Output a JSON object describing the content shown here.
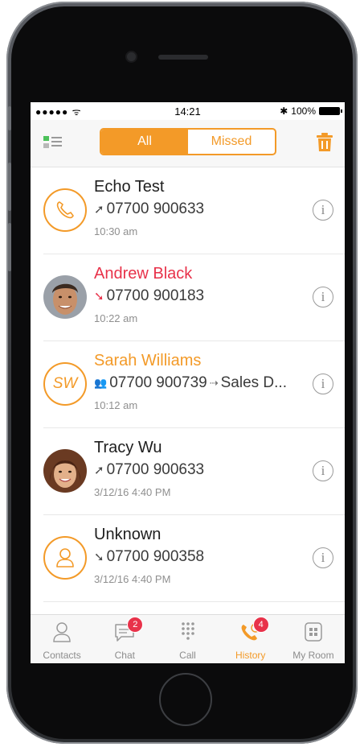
{
  "status": {
    "signal": "●●●●● ",
    "time": "14:21",
    "battery": "100%"
  },
  "header": {
    "tabs": [
      "All",
      "Missed"
    ],
    "active_tab": "All",
    "accent": "#f39a28"
  },
  "calls": [
    {
      "name": "Echo Test",
      "number": "07700 900633",
      "time": "10:30 am",
      "direction": "outgoing",
      "avatar": "phone-icon"
    },
    {
      "name": "Andrew Black",
      "number": "07700 900183",
      "time": "10:22 am",
      "direction": "missed",
      "avatar": "photo"
    },
    {
      "name": "Sarah Williams",
      "initials": "SW",
      "number": "07700 900739",
      "forward_to": "Sales D...",
      "time": "10:12 am",
      "direction": "group",
      "avatar": "initials"
    },
    {
      "name": "Tracy Wu",
      "number": "07700 900633",
      "time": "3/12/16 4:40 PM",
      "direction": "outgoing",
      "avatar": "photo"
    },
    {
      "name": "Unknown",
      "number": "07700 900358",
      "time": "3/12/16 4:40 PM",
      "direction": "incoming",
      "avatar": "person-icon"
    }
  ],
  "tabbar": {
    "contacts": "Contacts",
    "chat": "Chat",
    "chat_badge": "2",
    "call": "Call",
    "history": "History",
    "history_badge": "4",
    "myroom": "My Room"
  },
  "colors": {
    "accent": "#f39a28",
    "missed": "#e8324a",
    "badge": "#e8324a"
  }
}
